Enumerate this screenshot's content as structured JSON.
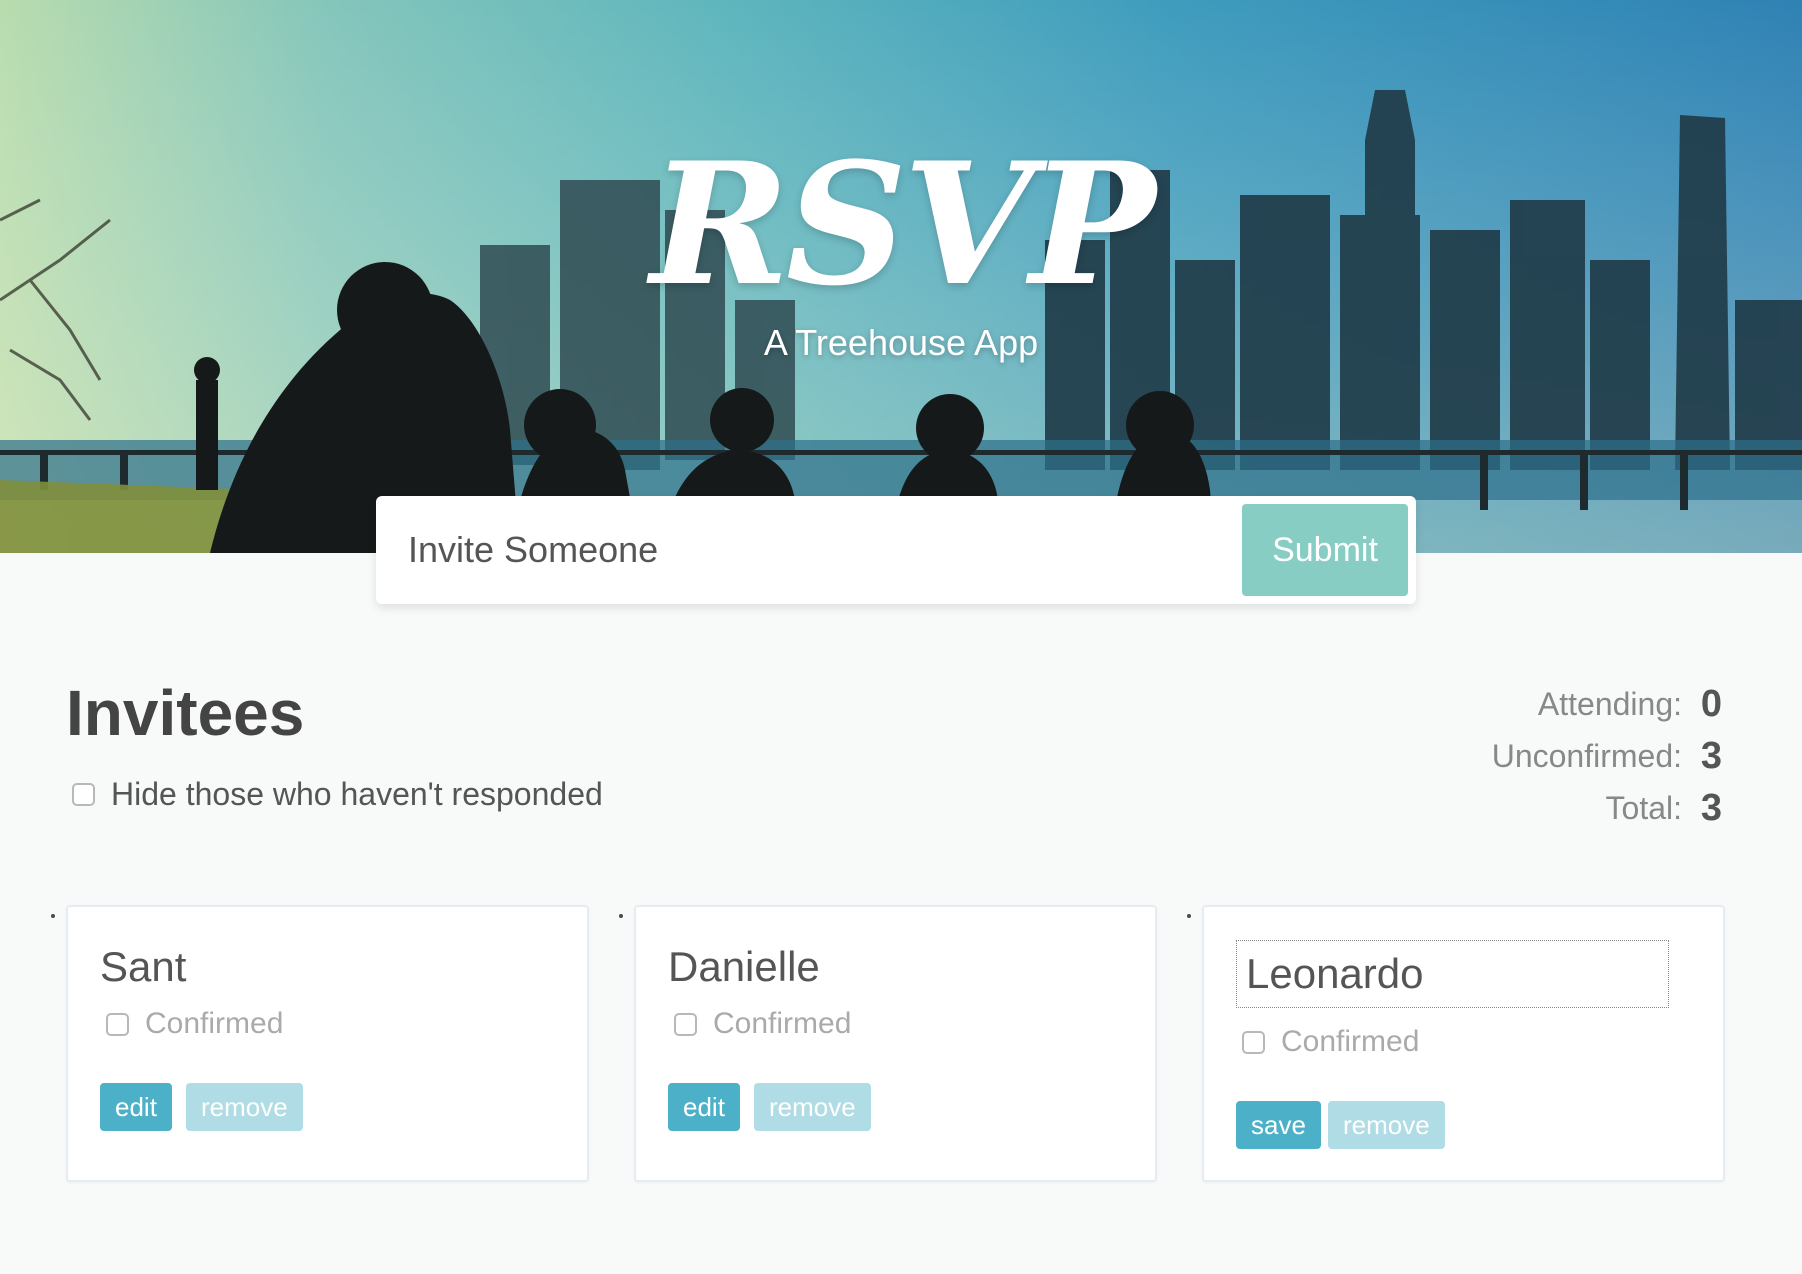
{
  "hero": {
    "title": "RSVP",
    "subtitle": "A Treehouse App"
  },
  "invite_form": {
    "placeholder": "Invite Someone",
    "submit_label": "Submit"
  },
  "invitees_section": {
    "title": "Invitees",
    "filter_label": "Hide those who haven't responded",
    "filter_checked": false
  },
  "counter": {
    "attending_label": "Attending:",
    "attending_value": "0",
    "unconfirmed_label": "Unconfirmed:",
    "unconfirmed_value": "3",
    "total_label": "Total:",
    "total_value": "3"
  },
  "cards": [
    {
      "name": "Sant",
      "confirmed_label": "Confirmed",
      "confirmed": false,
      "primary_action": "edit",
      "secondary_action": "remove",
      "editing": false
    },
    {
      "name": "Danielle",
      "confirmed_label": "Confirmed",
      "confirmed": false,
      "primary_action": "edit",
      "secondary_action": "remove",
      "editing": false
    },
    {
      "name": "Leonardo",
      "confirmed_label": "Confirmed",
      "confirmed": false,
      "primary_action": "save",
      "secondary_action": "remove",
      "editing": true
    }
  ],
  "colors": {
    "primary_button": "#4cb1c8",
    "secondary_button": "#b0dce5",
    "submit_button": "#88cdc4"
  }
}
